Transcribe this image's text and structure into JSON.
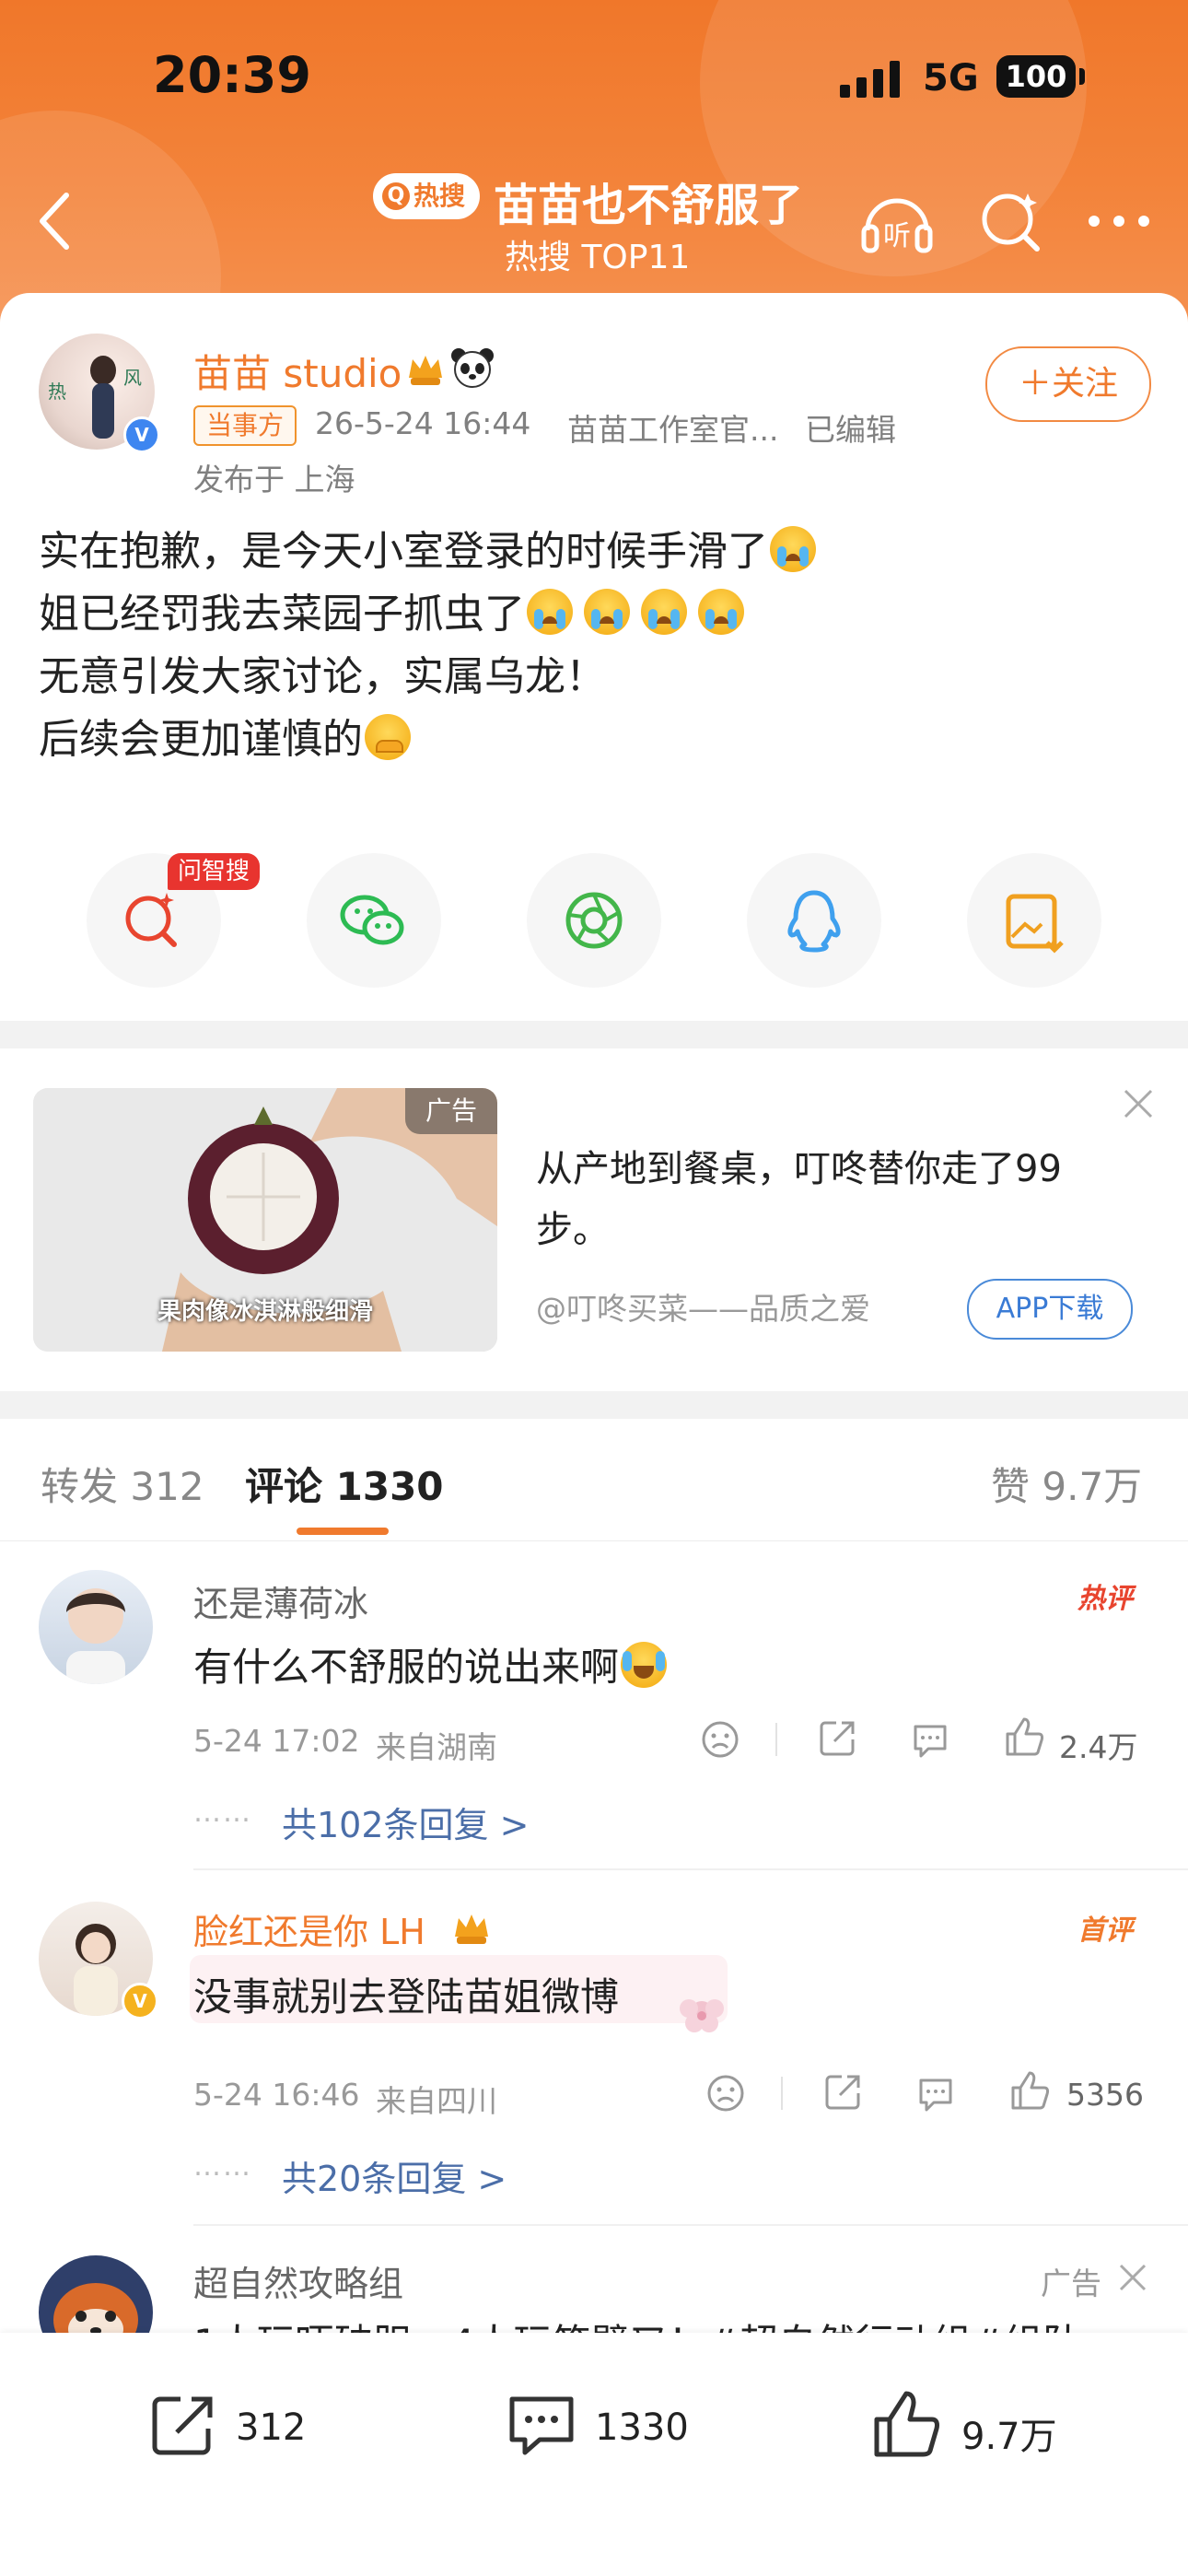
{
  "status_bar": {
    "time": "20:39",
    "network": "5G",
    "battery": "100"
  },
  "header": {
    "hot_badge": "热搜",
    "title": "苗苗也不舒服了",
    "subtitle": "热搜 TOP11"
  },
  "post": {
    "author": "苗苗 studio",
    "tag": "当事方",
    "datetime": "26-5-24 16:44",
    "source": "苗苗工作室官...",
    "edited": "已编辑",
    "location": "发布于 上海",
    "follow_label": "＋关注",
    "lines": [
      "实在抱歉，是今天小室登录的时候手滑了",
      "姐已经罚我去菜园子抓虫了",
      "无意引发大家讨论，实属乌龙！",
      "后续会更加谨慎的"
    ]
  },
  "share": {
    "ask_tag": "问智搜",
    "buttons": [
      "search-ai",
      "wechat",
      "moments",
      "qq",
      "save-image"
    ]
  },
  "ad": {
    "label": "广告",
    "caption": "果肉像冰淇淋般细滑",
    "text": "从产地到餐桌，叮咚替你走了99步。",
    "source": "@叮咚买菜——品质之爱",
    "cta": "APP下载"
  },
  "tabs": {
    "repost_label": "转发",
    "repost_count": "312",
    "comment_label": "评论",
    "comment_count": "1330",
    "like_label": "赞",
    "like_count": "9.7万"
  },
  "comments": [
    {
      "name": "还是薄荷冰",
      "badge": "热评",
      "text": "有什么不舒服的说出来啊",
      "time": "5-24 17:02",
      "location": "来自湖南",
      "likes": "2.4万",
      "dots": "……",
      "replies": "共102条回复 >"
    },
    {
      "name": "脸红还是你 LH",
      "badge": "首评",
      "text": "没事就别去登陆苗姐微博",
      "time": "5-24 16:46",
      "location": "来自四川",
      "likes": "5356",
      "dots": "……",
      "replies": "共20条回复 >"
    },
    {
      "name": "超自然攻略组",
      "badge": "广告",
      "text": "1人玩吓破胆，4人玩笑劈叉！#超自然行动组#组队"
    }
  ],
  "bottom_bar": {
    "repost": "312",
    "comment": "1330",
    "like": "9.7万"
  },
  "colors": {
    "accent": "#f07a2d",
    "link": "#4b6ea8",
    "hot": "#e8452f"
  }
}
